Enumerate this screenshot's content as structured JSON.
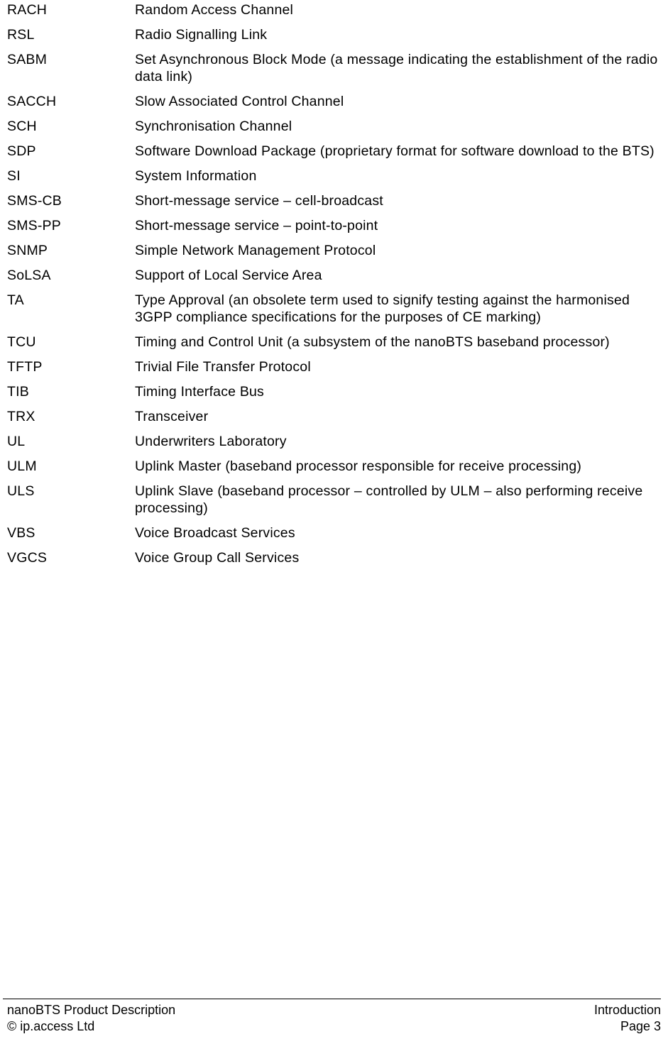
{
  "document": {
    "type": "glossary",
    "entries": [
      {
        "term": "RACH",
        "definition": "Random Access Channel"
      },
      {
        "term": "RSL",
        "definition": "Radio Signalling Link"
      },
      {
        "term": "SABM",
        "definition": "Set Asynchronous Block Mode (a message indicating the establishment of the radio data link)"
      },
      {
        "term": "SACCH",
        "definition": "Slow Associated Control Channel"
      },
      {
        "term": "SCH",
        "definition": "Synchronisation Channel"
      },
      {
        "term": "SDP",
        "definition": "Software Download Package (proprietary format for software download to the BTS)"
      },
      {
        "term": "SI",
        "definition": "System Information"
      },
      {
        "term": "SMS-CB",
        "definition": "Short-message service – cell-broadcast"
      },
      {
        "term": "SMS-PP",
        "definition": "Short-message service – point-to-point"
      },
      {
        "term": "SNMP",
        "definition": "Simple Network Management Protocol"
      },
      {
        "term": "SoLSA",
        "definition": "Support of Local Service Area"
      },
      {
        "term": "TA",
        "definition": "Type Approval (an obsolete term used to signify testing against the harmonised 3GPP compliance specifications for the purposes of CE marking)"
      },
      {
        "term": "TCU",
        "definition": "Timing and Control Unit (a subsystem of the nanoBTS baseband processor)"
      },
      {
        "term": "TFTP",
        "definition": "Trivial File Transfer Protocol"
      },
      {
        "term": "TIB",
        "definition": "Timing Interface Bus"
      },
      {
        "term": "TRX",
        "definition": "Transceiver"
      },
      {
        "term": "UL",
        "definition": "Underwriters Laboratory"
      },
      {
        "term": "ULM",
        "definition": "Uplink Master (baseband processor responsible for receive processing)"
      },
      {
        "term": "ULS",
        "definition": "Uplink Slave (baseband processor – controlled by ULM – also performing receive processing)"
      },
      {
        "term": "VBS",
        "definition": "Voice Broadcast Services"
      },
      {
        "term": "VGCS",
        "definition": "Voice Group Call Services"
      }
    ]
  },
  "footer": {
    "title": "nanoBTS Product Description",
    "copyright": "© ip.access Ltd",
    "section": "Introduction",
    "page": "Page 3"
  }
}
